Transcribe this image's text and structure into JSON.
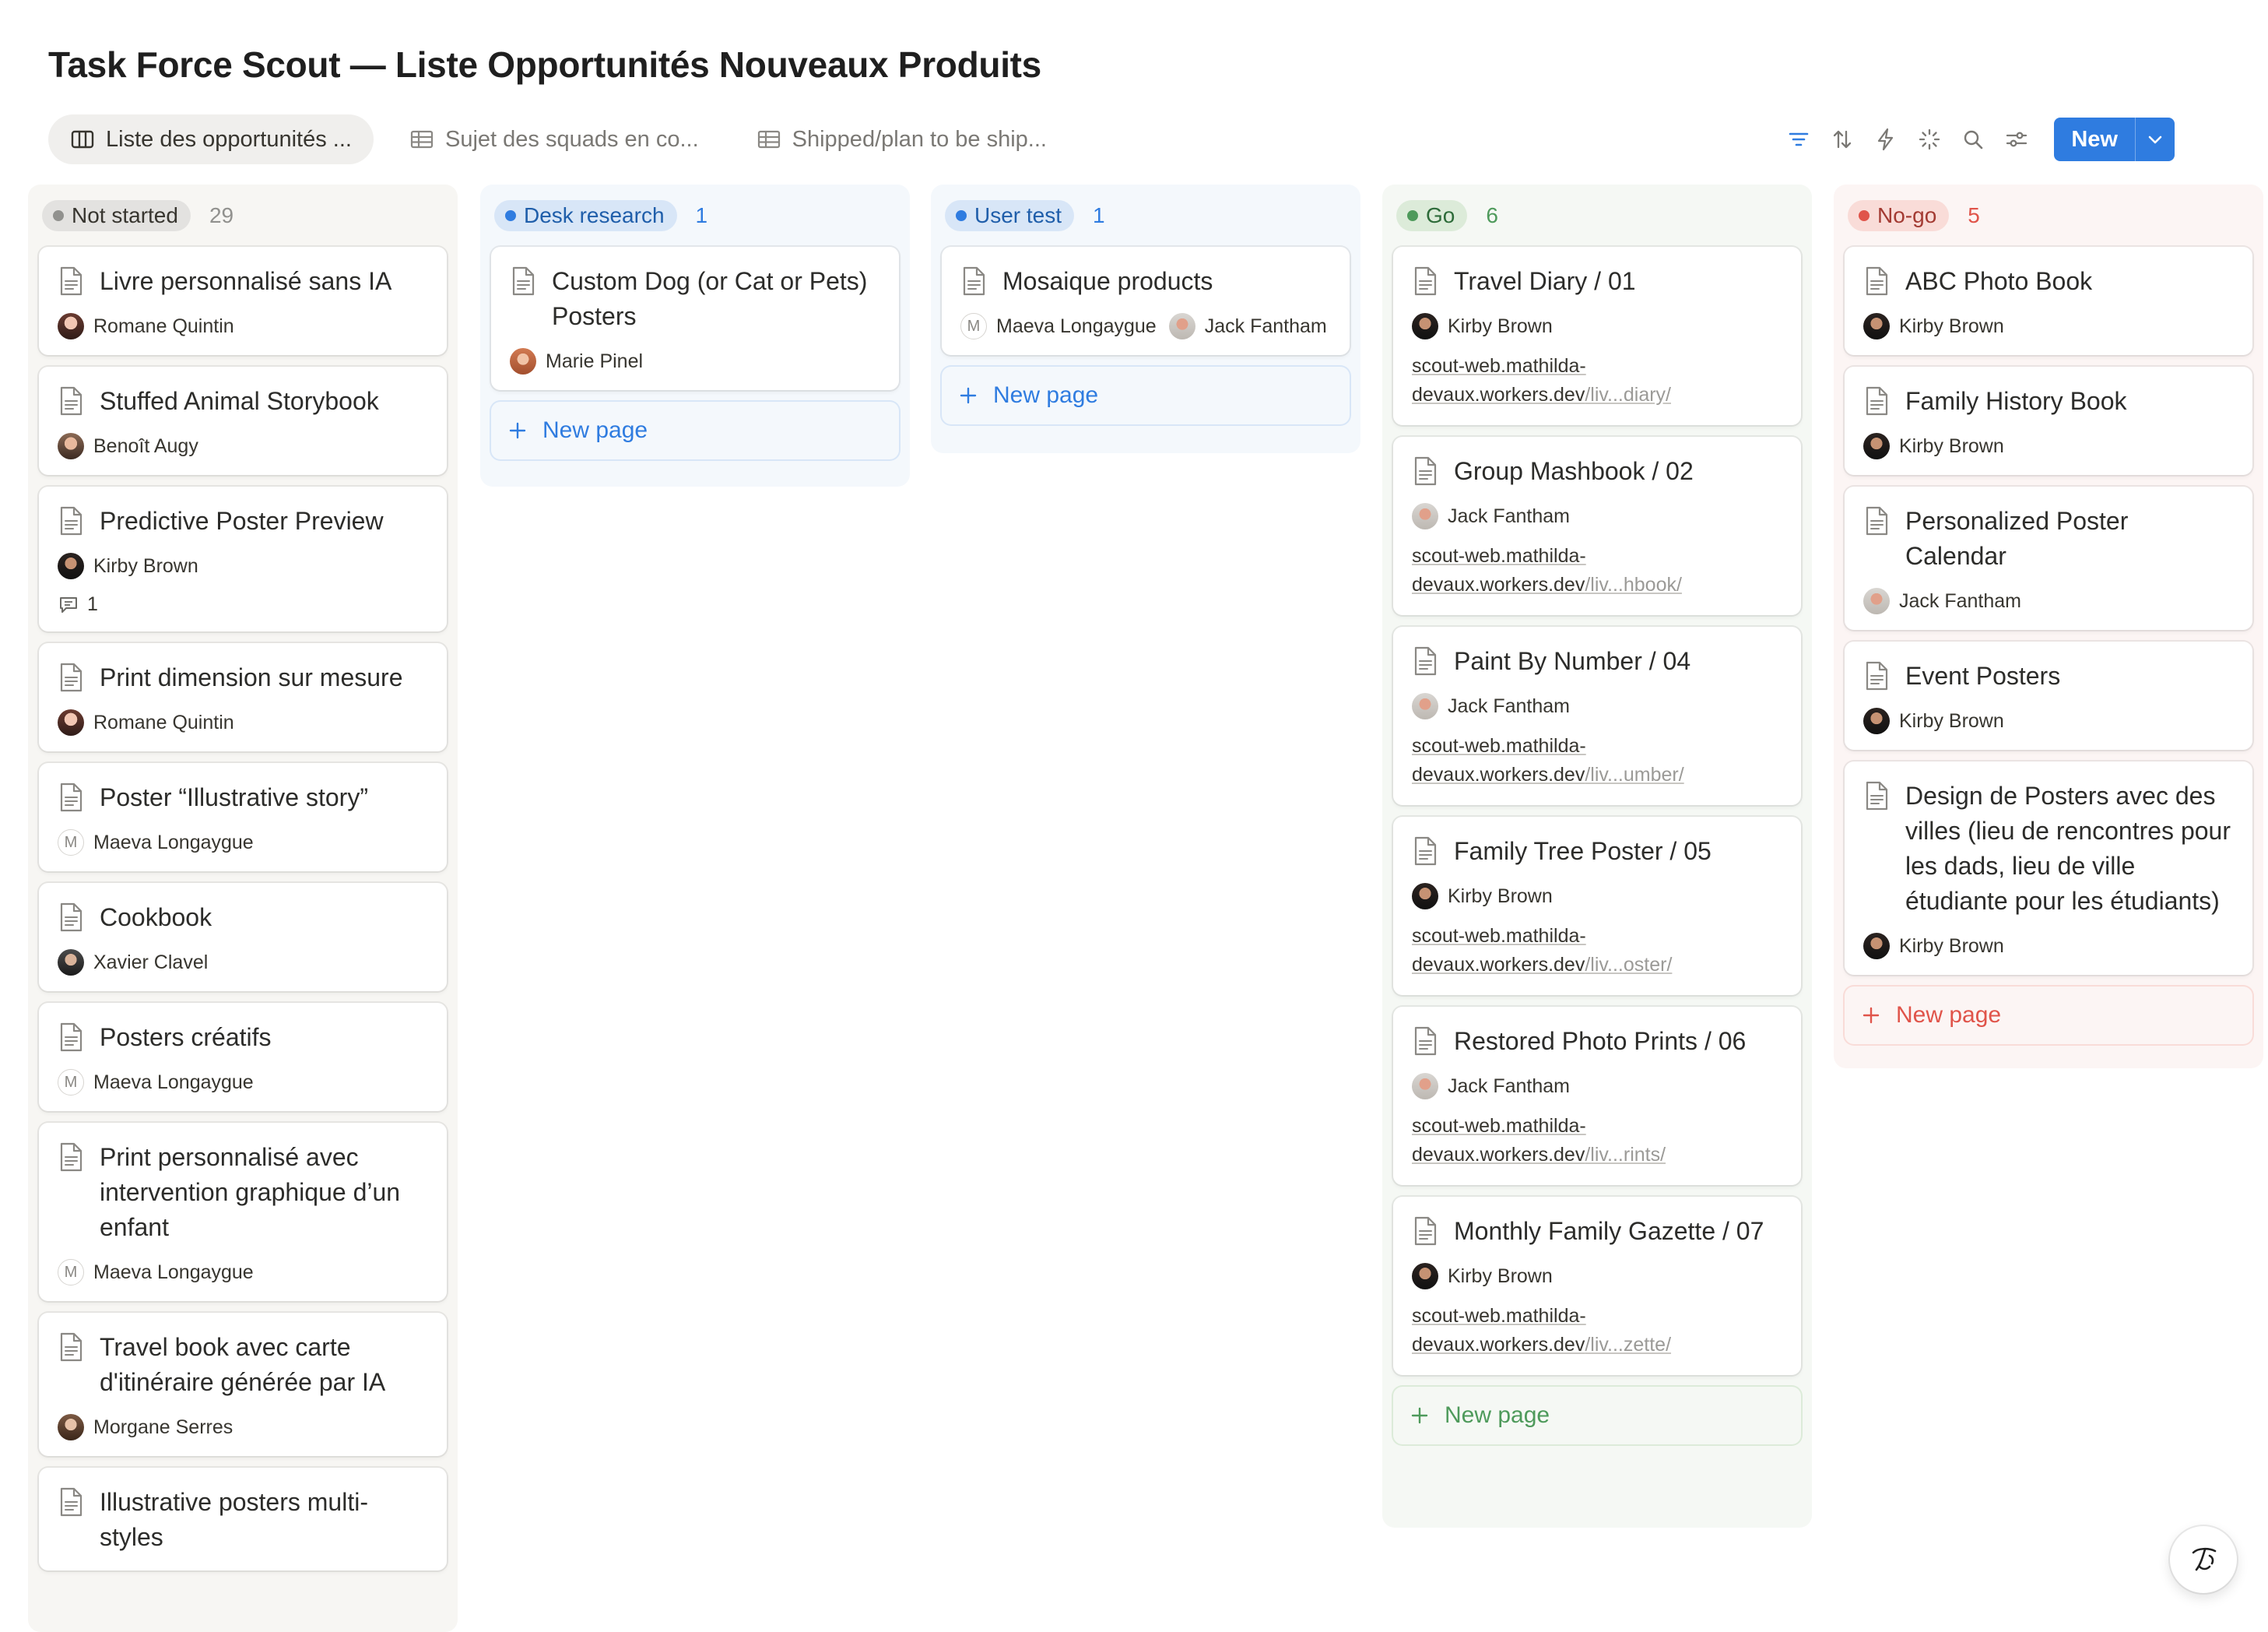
{
  "page_title": "Task Force Scout — Liste Opportunités Nouveaux Produits",
  "tabs": [
    {
      "label": "Liste des opportunités ...",
      "icon": "board-icon",
      "active": true
    },
    {
      "label": "Sujet des squads en co...",
      "icon": "table-icon",
      "active": false
    },
    {
      "label": "Shipped/plan to be ship...",
      "icon": "table-icon",
      "active": false
    }
  ],
  "toolbar": {
    "icons": [
      "filter-icon",
      "sort-icon",
      "automation-icon",
      "suggestions-icon",
      "search-icon",
      "settings-icon"
    ],
    "new_label": "New"
  },
  "board": {
    "new_page_label": "New page",
    "columns": [
      {
        "status": "Not started",
        "count": "29",
        "colors": {
          "bg": "#f7f6f3",
          "pill": "#e3e2e0",
          "dot": "#91918e",
          "text": "#37352f"
        },
        "cards": [
          {
            "title": "Livre personnalisé sans IA",
            "people": [
              "Romane Quintin"
            ]
          },
          {
            "title": "Stuffed Animal Storybook",
            "people": [
              "Benoît Augy"
            ]
          },
          {
            "title": "Predictive Poster Preview",
            "people": [
              "Kirby Brown"
            ],
            "comments": "1"
          },
          {
            "title": "Print dimension sur mesure",
            "people": [
              "Romane Quintin"
            ]
          },
          {
            "title": "Poster “Illustrative story”",
            "people": [
              "Maeva Longaygue"
            ]
          },
          {
            "title": "Cookbook",
            "people": [
              "Xavier Clavel"
            ]
          },
          {
            "title": "Posters créatifs",
            "people": [
              "Maeva Longaygue"
            ]
          },
          {
            "title": "Print personnalisé avec intervention graphique d’un enfant",
            "people": [
              "Maeva Longaygue"
            ]
          },
          {
            "title": "Travel book avec carte d'itinéraire générée par IA",
            "people": [
              "Morgane Serres"
            ]
          },
          {
            "title": "Illustrative posters multi-styles",
            "people": []
          }
        ]
      },
      {
        "status": "Desk research",
        "count": "1",
        "colors": {
          "bg": "#f4f8fc",
          "pill": "#d8e6f7",
          "dot": "#2f7ce0",
          "text": "#1f5eaa"
        },
        "cards": [
          {
            "title": "Custom Dog (or Cat or Pets) Posters",
            "people": [
              "Marie Pinel"
            ]
          }
        ]
      },
      {
        "status": "User test",
        "count": "1",
        "colors": {
          "bg": "#f4f8fc",
          "pill": "#d8e6f7",
          "dot": "#2f7ce0",
          "text": "#1f5eaa"
        },
        "cards": [
          {
            "title": "Mosaique products",
            "people": [
              "Maeva Longaygue",
              "Jack Fantham"
            ]
          }
        ]
      },
      {
        "status": "Go",
        "count": "6",
        "colors": {
          "bg": "#f5f8f4",
          "pill": "#dcebd9",
          "dot": "#4e9a5b",
          "text": "#2d6b39"
        },
        "cards": [
          {
            "title": "Travel Diary / 01",
            "people": [
              "Kirby Brown"
            ],
            "link": {
              "host1": "scout-web.mathilda-",
              "host2": "devaux.workers.dev",
              "path": "/liv...diary/"
            }
          },
          {
            "title": "Group Mashbook / 02",
            "people": [
              "Jack Fantham"
            ],
            "link": {
              "host1": "scout-web.mathilda-",
              "host2": "devaux.workers.dev",
              "path": "/liv...hbook/"
            }
          },
          {
            "title": "Paint By Number / 04",
            "people": [
              "Jack Fantham"
            ],
            "link": {
              "host1": "scout-web.mathilda-",
              "host2": "devaux.workers.dev",
              "path": "/liv...umber/"
            }
          },
          {
            "title": "Family Tree Poster / 05",
            "people": [
              "Kirby Brown"
            ],
            "link": {
              "host1": "scout-web.mathilda-",
              "host2": "devaux.workers.dev",
              "path": "/liv...oster/"
            }
          },
          {
            "title": "Restored Photo Prints / 06",
            "people": [
              "Jack Fantham"
            ],
            "link": {
              "host1": "scout-web.mathilda-",
              "host2": "devaux.workers.dev",
              "path": "/liv...rints/"
            }
          },
          {
            "title": "Monthly Family Gazette / 07",
            "people": [
              "Kirby Brown"
            ],
            "link": {
              "host1": "scout-web.mathilda-",
              "host2": "devaux.workers.dev",
              "path": "/liv...zette/"
            }
          }
        ]
      },
      {
        "status": "No-go",
        "count": "5",
        "colors": {
          "bg": "#fcf5f4",
          "pill": "#f9dcd8",
          "dot": "#e0544a",
          "text": "#a33a32"
        },
        "cards": [
          {
            "title": "ABC Photo Book",
            "people": [
              "Kirby Brown"
            ]
          },
          {
            "title": "Family History Book",
            "people": [
              "Kirby Brown"
            ]
          },
          {
            "title": "Personalized Poster Calendar",
            "people": [
              "Jack Fantham"
            ]
          },
          {
            "title": "Event Posters",
            "people": [
              "Kirby Brown"
            ]
          },
          {
            "title": "Design de Posters avec des villes (lieu de rencontres pour les dads, lieu de ville étudiante pour les étudiants)",
            "people": [
              "Kirby Brown"
            ]
          }
        ]
      }
    ]
  }
}
